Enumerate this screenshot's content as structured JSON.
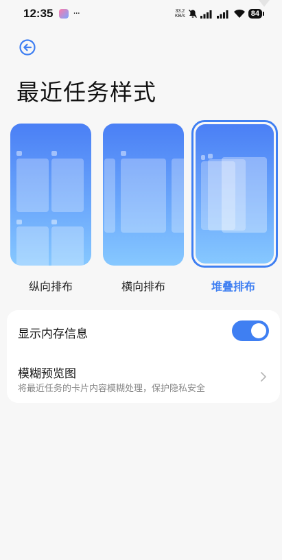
{
  "status_bar": {
    "time": "12:35",
    "more": "···",
    "speed_top": "33.2",
    "speed_unit": "KB/s",
    "battery": "84"
  },
  "header": {
    "title": "最近任务样式",
    "back_icon": "back-arrow-icon"
  },
  "styles": {
    "options": [
      {
        "label": "纵向排布",
        "selected": false
      },
      {
        "label": "横向排布",
        "selected": false
      },
      {
        "label": "堆叠排布",
        "selected": true
      }
    ]
  },
  "settings": {
    "show_memory": {
      "label": "显示内存信息",
      "enabled": true
    },
    "blur_preview": {
      "label": "模糊预览图",
      "description": "将最近任务的卡片内容模糊处理，保护隐私安全"
    }
  },
  "colors": {
    "accent": "#3f7ff2",
    "background": "#f7f7f7"
  }
}
